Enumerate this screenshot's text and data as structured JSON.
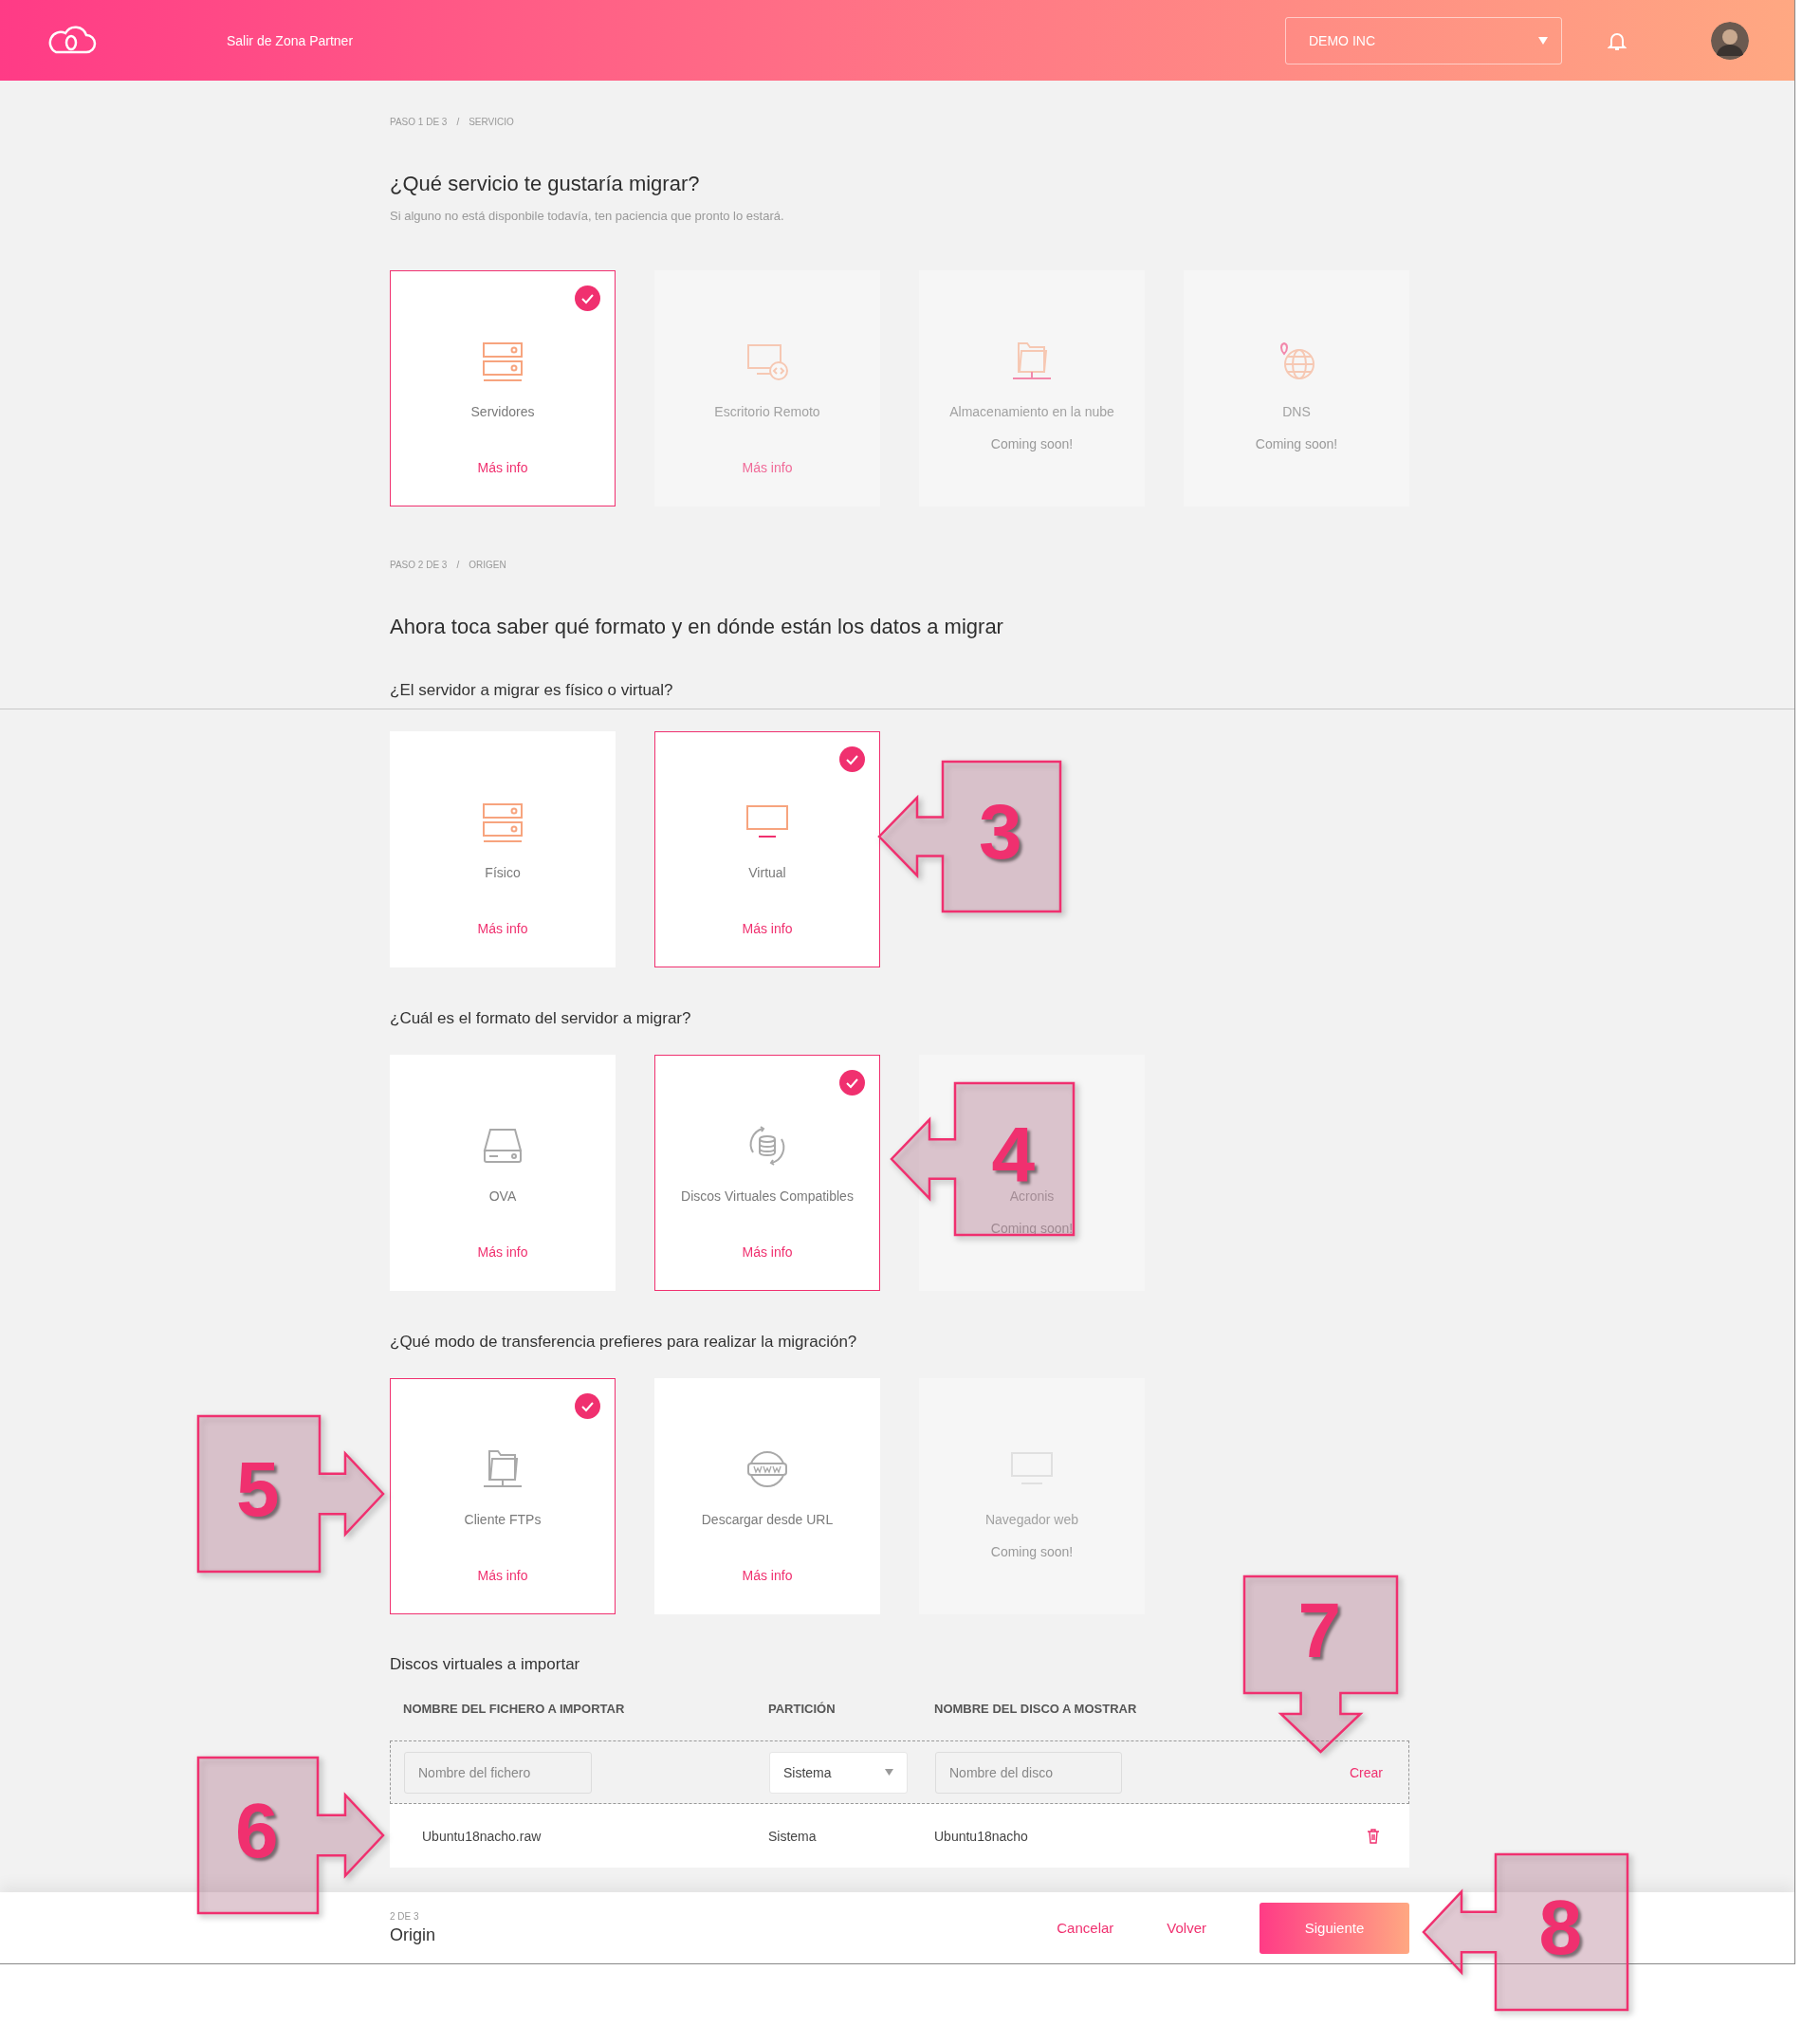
{
  "header": {
    "exit_link": "Salir de Zona Partner",
    "company": "DEMO INC"
  },
  "steps": [
    {
      "breadcrumb": {
        "step": "PASO 1 DE 3",
        "separator": "/",
        "section": "SERVICIO"
      },
      "title": "¿Qué servicio te gustaría migrar?",
      "subtitle": "Si alguno no está disponbile todavía, ten paciencia que pronto lo estará.",
      "groups": [
        {
          "options": [
            {
              "kind": "server",
              "label": "Servidores",
              "link": "Más info",
              "selected": true,
              "disabled": false
            },
            {
              "kind": "remote",
              "label": "Escritorio Remoto",
              "link": "Más info",
              "selected": false,
              "disabled": true
            },
            {
              "kind": "cloud-folder",
              "label": "Almacenamiento en la nube",
              "note": "Coming soon!",
              "selected": false,
              "disabled": true
            },
            {
              "kind": "globe",
              "label": "DNS",
              "note": "Coming soon!",
              "selected": false,
              "disabled": true
            }
          ]
        }
      ]
    },
    {
      "breadcrumb": {
        "step": "PASO 2 DE 3",
        "separator": "/",
        "section": "ORIGEN"
      },
      "title": "Ahora toca saber qué formato y en dónde están los datos a migrar",
      "groups": [
        {
          "question": "¿El servidor a migrar es físico o virtual?",
          "divider_below": true,
          "options": [
            {
              "kind": "server",
              "label": "Físico",
              "link": "Más info",
              "selected": false,
              "disabled": false
            },
            {
              "kind": "screen",
              "label": "Virtual",
              "link": "Más info",
              "selected": true,
              "disabled": false
            }
          ]
        },
        {
          "question": "¿Cuál es el formato del servidor a migrar?",
          "options": [
            {
              "kind": "drive",
              "label": "OVA",
              "link": "Más info",
              "selected": false,
              "disabled": false
            },
            {
              "kind": "disk-sync",
              "label": "Discos Virtuales Compatibles",
              "link": "Más info",
              "selected": true,
              "disabled": false
            },
            {
              "label": "Acronis",
              "note": "Coming soon!",
              "selected": false,
              "disabled": true
            }
          ]
        },
        {
          "question": "¿Qué modo de transferencia prefieres para realizar la migración?",
          "options": [
            {
              "kind": "ftp-folder",
              "label": "Cliente FTPs",
              "link": "Más info",
              "selected": true,
              "disabled": false
            },
            {
              "kind": "www",
              "label": "Descargar desde URL",
              "link": "Más info",
              "selected": false,
              "disabled": false
            },
            {
              "kind": "browser",
              "label": "Navegador web",
              "note": "Coming soon!",
              "selected": false,
              "disabled": true
            }
          ]
        }
      ]
    }
  ],
  "disks": {
    "title": "Discos virtuales a importar",
    "columns": [
      "NOMBRE DEL FICHERO A IMPORTAR",
      "PARTICIÓN",
      "NOMBRE DEL DISCO A MOSTRAR"
    ],
    "new_row": {
      "file_placeholder": "Nombre del fichero",
      "partition": "Sistema",
      "disk_placeholder": "Nombre del disco",
      "action": "Crear"
    },
    "rows": [
      {
        "file": "Ubuntu18nacho.raw",
        "partition": "Sistema",
        "disk": "Ubuntu18nacho"
      }
    ]
  },
  "footer": {
    "step": "2 DE 3",
    "name": "Origin",
    "cancel": "Cancelar",
    "back": "Volver",
    "next": "Siguiente"
  },
  "callouts": [
    {
      "number": "3",
      "kind": "left"
    },
    {
      "number": "4",
      "kind": "left"
    },
    {
      "number": "5",
      "kind": "right"
    },
    {
      "number": "6",
      "kind": "right"
    },
    {
      "number": "7",
      "kind": "down"
    },
    {
      "number": "8",
      "kind": "left"
    }
  ]
}
